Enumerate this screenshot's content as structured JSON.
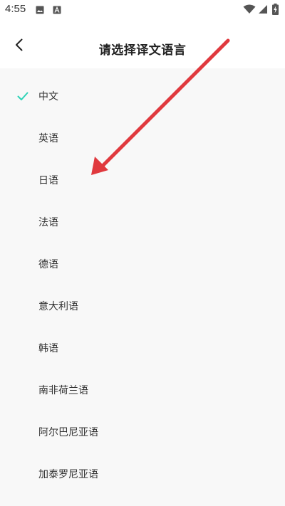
{
  "status_bar": {
    "time": "4:55",
    "left_icons": [
      "image-icon",
      "a-icon"
    ],
    "right_icons": [
      "wifi-icon",
      "signal-icon",
      "battery-charging-icon"
    ]
  },
  "header": {
    "title": "请选择译文语言",
    "back_icon": "chevron-left-icon"
  },
  "languages": [
    {
      "label": "中文",
      "selected": true
    },
    {
      "label": "英语",
      "selected": false
    },
    {
      "label": "日语",
      "selected": false
    },
    {
      "label": "法语",
      "selected": false
    },
    {
      "label": "德语",
      "selected": false
    },
    {
      "label": "意大利语",
      "selected": false
    },
    {
      "label": "韩语",
      "selected": false
    },
    {
      "label": "南非荷兰语",
      "selected": false
    },
    {
      "label": "阿尔巴尼亚语",
      "selected": false
    },
    {
      "label": "加泰罗尼亚语",
      "selected": false
    }
  ],
  "colors": {
    "accent_check": "#2ed3b7",
    "annotation_arrow": "#e0393e",
    "list_background": "#f8f8f8"
  }
}
